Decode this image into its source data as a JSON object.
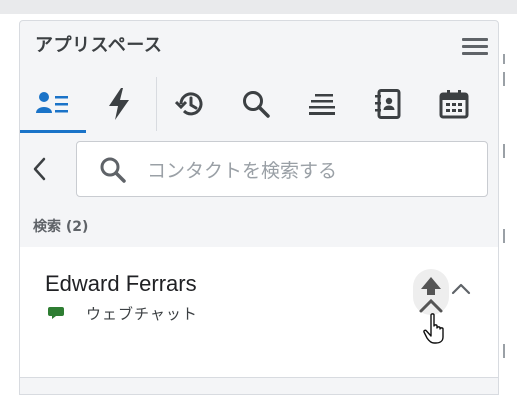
{
  "panel": {
    "title": "アプリスペース"
  },
  "tabs": [
    {
      "name": "contacts",
      "icon": "contacts-icon",
      "active": true
    },
    {
      "name": "quick-actions",
      "icon": "lightning-icon",
      "active": false
    },
    {
      "name": "history",
      "icon": "history-icon",
      "active": false
    },
    {
      "name": "search",
      "icon": "search-icon",
      "active": false
    },
    {
      "name": "queue",
      "icon": "queue-icon",
      "active": false
    },
    {
      "name": "directory",
      "icon": "address-book-icon",
      "active": false
    },
    {
      "name": "calendar",
      "icon": "calendar-icon",
      "active": false
    }
  ],
  "search": {
    "placeholder": "コンタクトを検索する",
    "value": ""
  },
  "results": {
    "label": "検索 (2)"
  },
  "contact": {
    "name": "Edward Ferrars",
    "channel": "ウェブチャット"
  },
  "colors": {
    "accent": "#1a73c8",
    "icon": "#3c4043",
    "chat_icon": "#2e7d32",
    "panel_bg": "#f4f5f7"
  }
}
